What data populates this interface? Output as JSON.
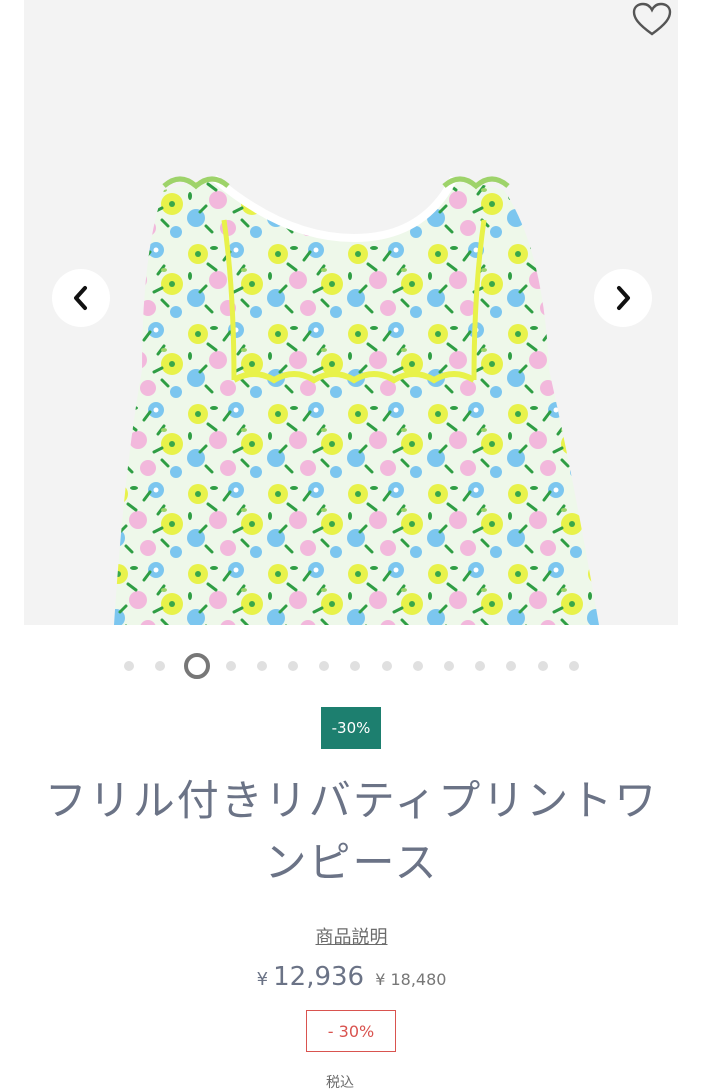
{
  "gallery": {
    "image_alt": "フリル付きリバティプリントワンピース",
    "favorite_icon": "heart-outline-icon",
    "prev_icon": "chevron-left-icon",
    "next_icon": "chevron-right-icon",
    "slide_count": 15,
    "active_index": 2
  },
  "product": {
    "discount_badge": "-30%",
    "title_line1": "フリル付きリバティプリントワ",
    "title_line2": "ンピース",
    "description_link": "商品説明",
    "price_currency": "¥",
    "price_sale": "12,936",
    "price_original": "¥ 18,480",
    "discount_label": "- 30%",
    "next_section_label": "税込"
  },
  "colors": {
    "accent_badge": "#1d7f6f",
    "title_text": "#6b7386",
    "discount_red": "#d9534f"
  }
}
